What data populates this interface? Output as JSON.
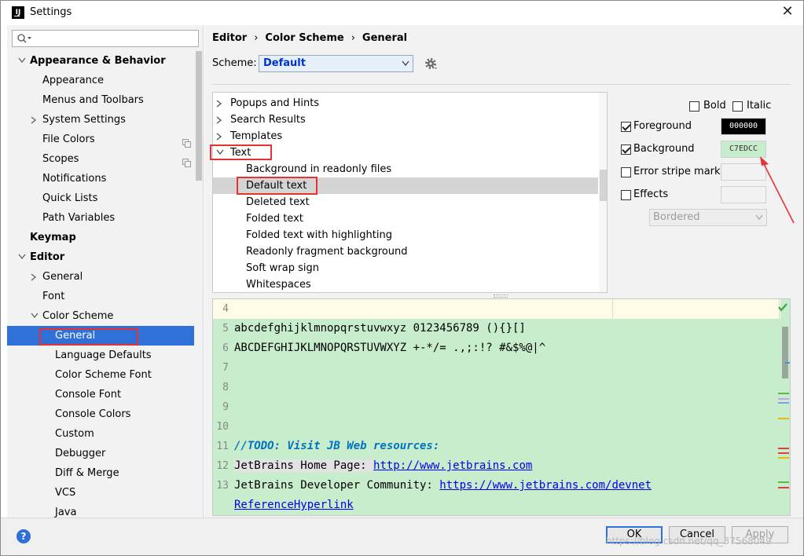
{
  "window": {
    "title": "Settings",
    "app_icon_text": "IJ"
  },
  "search": {
    "placeholder": ""
  },
  "sidebar": {
    "items": [
      {
        "label": "Appearance & Behavior",
        "level": 0,
        "expand": "open",
        "bold": true
      },
      {
        "label": "Appearance",
        "level": 1,
        "expand": ""
      },
      {
        "label": "Menus and Toolbars",
        "level": 1,
        "expand": ""
      },
      {
        "label": "System Settings",
        "level": 1,
        "expand": "closed"
      },
      {
        "label": "File Colors",
        "level": 1,
        "expand": "",
        "copy": true
      },
      {
        "label": "Scopes",
        "level": 1,
        "expand": "",
        "copy": true
      },
      {
        "label": "Notifications",
        "level": 1,
        "expand": ""
      },
      {
        "label": "Quick Lists",
        "level": 1,
        "expand": ""
      },
      {
        "label": "Path Variables",
        "level": 1,
        "expand": ""
      },
      {
        "label": "Keymap",
        "level": 0,
        "expand": "",
        "bold": true
      },
      {
        "label": "Editor",
        "level": 0,
        "expand": "open",
        "bold": true
      },
      {
        "label": "General",
        "level": 1,
        "expand": "closed"
      },
      {
        "label": "Font",
        "level": 1,
        "expand": ""
      },
      {
        "label": "Color Scheme",
        "level": 1,
        "expand": "open"
      },
      {
        "label": "General",
        "level": 2,
        "expand": "",
        "selected": true
      },
      {
        "label": "Language Defaults",
        "level": 2,
        "expand": ""
      },
      {
        "label": "Color Scheme Font",
        "level": 2,
        "expand": ""
      },
      {
        "label": "Console Font",
        "level": 2,
        "expand": ""
      },
      {
        "label": "Console Colors",
        "level": 2,
        "expand": ""
      },
      {
        "label": "Custom",
        "level": 2,
        "expand": ""
      },
      {
        "label": "Debugger",
        "level": 2,
        "expand": ""
      },
      {
        "label": "Diff & Merge",
        "level": 2,
        "expand": ""
      },
      {
        "label": "VCS",
        "level": 2,
        "expand": ""
      },
      {
        "label": "Java",
        "level": 2,
        "expand": ""
      }
    ]
  },
  "breadcrumb": {
    "items": [
      "Editor",
      "Color Scheme",
      "General"
    ],
    "separator": "›"
  },
  "scheme": {
    "label": "Scheme:",
    "value": "Default"
  },
  "attributes": {
    "items": [
      {
        "label": "Popups and Hints",
        "level": 0,
        "expand": "closed"
      },
      {
        "label": "Search Results",
        "level": 0,
        "expand": "closed"
      },
      {
        "label": "Templates",
        "level": 0,
        "expand": "closed"
      },
      {
        "label": "Text",
        "level": 0,
        "expand": "open"
      },
      {
        "label": "Background in readonly files",
        "level": 1,
        "expand": ""
      },
      {
        "label": "Default text",
        "level": 1,
        "expand": "",
        "selected": true
      },
      {
        "label": "Deleted text",
        "level": 1,
        "expand": ""
      },
      {
        "label": "Folded text",
        "level": 1,
        "expand": ""
      },
      {
        "label": "Folded text with highlighting",
        "level": 1,
        "expand": ""
      },
      {
        "label": "Readonly fragment background",
        "level": 1,
        "expand": ""
      },
      {
        "label": "Soft wrap sign",
        "level": 1,
        "expand": ""
      },
      {
        "label": "Whitespaces",
        "level": 1,
        "expand": ""
      }
    ]
  },
  "options": {
    "bold": {
      "label": "Bold",
      "checked": false
    },
    "italic": {
      "label": "Italic",
      "checked": false
    },
    "foreground": {
      "label": "Foreground",
      "checked": true,
      "value": "000000",
      "color": "#000000",
      "text_color": "#ffffff"
    },
    "background": {
      "label": "Background",
      "checked": true,
      "value": "C7EDCC",
      "color": "#c7edcc",
      "text_color": "#333333"
    },
    "error_stripe": {
      "label": "Error stripe mark",
      "checked": false
    },
    "effects": {
      "label": "Effects",
      "checked": false,
      "type": "Bordered"
    }
  },
  "preview": {
    "lines": [
      {
        "num": "4",
        "parts": []
      },
      {
        "num": "5",
        "parts": [
          {
            "t": "abcdefghijklmnopqrstuvwxyz 0123456789 (){}[]",
            "k": "plain"
          }
        ]
      },
      {
        "num": "6",
        "parts": [
          {
            "t": "ABCDEFGHIJKLMNOPQRSTUVWXYZ +-*/= .,;:!? #&$%@|^",
            "k": "plain"
          }
        ]
      },
      {
        "num": "7",
        "parts": []
      },
      {
        "num": "8",
        "parts": []
      },
      {
        "num": "9",
        "parts": []
      },
      {
        "num": "10",
        "parts": []
      },
      {
        "num": "11",
        "parts": [
          {
            "t": "//TODO: Visit JB Web resources:",
            "k": "todo"
          }
        ]
      },
      {
        "num": "12",
        "parts": [
          {
            "t": "JetBrains Home Page: ",
            "k": "hl"
          },
          {
            "t": "http://www.jetbrains.com",
            "k": "link"
          }
        ]
      },
      {
        "num": "13",
        "parts": [
          {
            "t": "JetBrains Developer Community: ",
            "k": "plain"
          },
          {
            "t": "https://www.jetbrains.com/devnet",
            "k": "link"
          }
        ]
      },
      {
        "num": "",
        "parts": [
          {
            "t": "ReferenceHyperlink",
            "k": "link"
          }
        ]
      }
    ],
    "background": "#c7edcc"
  },
  "buttons": {
    "help": "?",
    "ok": "OK",
    "cancel": "Cancel",
    "apply": "Apply"
  },
  "watermark": "https://blog.csdn.net/qq_37568049",
  "colors": {
    "selection": "#2f71d8",
    "annotation": "#e53333",
    "todo": "#0073bf",
    "link": "#0000ee"
  }
}
